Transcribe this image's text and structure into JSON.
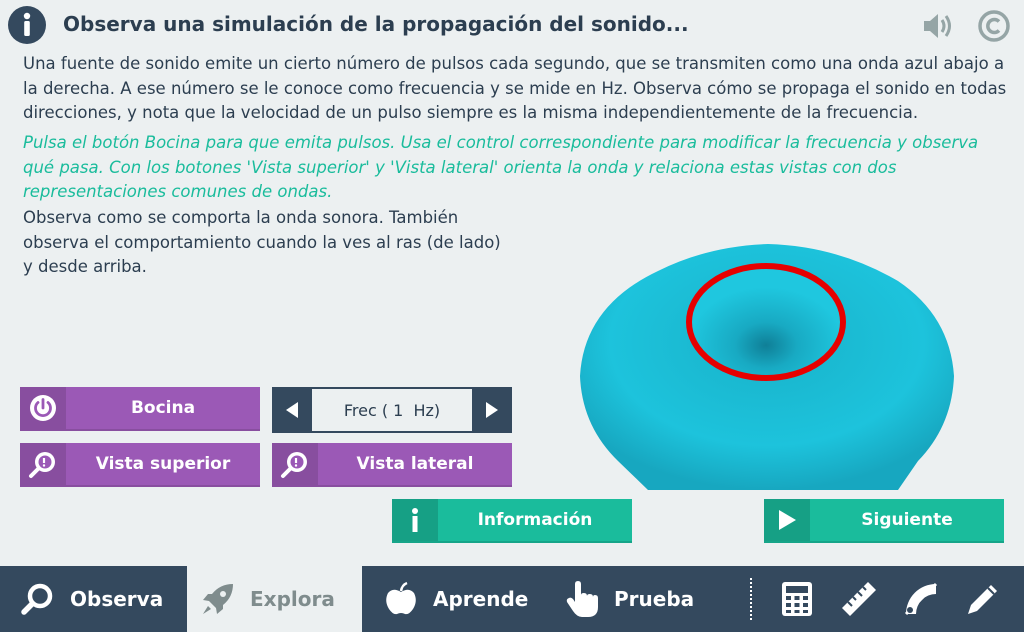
{
  "header": {
    "title": "Observa una simulación de la propagación del sonido...",
    "icons": [
      "info-icon",
      "speaker-icon",
      "copyright-icon"
    ]
  },
  "paragraphs": {
    "intro": "Una fuente de sonido emite un cierto número de pulsos cada segundo, que se transmiten como una onda azul abajo a la derecha. A ese número se le conoce como frecuencia y se mide en Hz. Observa cómo se propaga el sonido en todas direcciones, y nota que la velocidad de un pulso siempre es la misma independientemente de la frecuencia.",
    "instructions": "Pulsa el botón Bocina para que emita pulsos. Usa el control correspondiente para modificar la frecuencia y observa qué pasa. Con los botones 'Vista superior' y 'Vista lateral' orienta la onda y relaciona estas vistas con dos representaciones comunes de ondas.",
    "observe": "Observa como se comporta la onda sonora. También observa el comportamiento cuando la ves al ras (de lado) y desde arriba."
  },
  "controls": {
    "bocina_label": "Bocina",
    "frequency_display": "Frec ( 1  Hz)",
    "vista_superior_label": "Vista superior",
    "vista_lateral_label": "Vista lateral",
    "informacion_label": "Información",
    "siguiente_label": "Siguiente"
  },
  "nav": {
    "items": [
      {
        "label": "Observa",
        "icon": "search-icon",
        "active": false
      },
      {
        "label": "Explora",
        "icon": "rocket-icon",
        "active": true
      },
      {
        "label": "Aprende",
        "icon": "apple-icon",
        "active": false
      },
      {
        "label": "Prueba",
        "icon": "hand-pointer-icon",
        "active": false
      }
    ],
    "tools": [
      "calculator-icon",
      "ruler-icon",
      "protractor-icon",
      "pencil-icon"
    ]
  },
  "colors": {
    "background": "#ecf0f1",
    "dark": "#34495e",
    "purple": "#9b59b6",
    "green": "#1abc9c",
    "wave": "#1ab5cc",
    "ring": "#e60000"
  }
}
